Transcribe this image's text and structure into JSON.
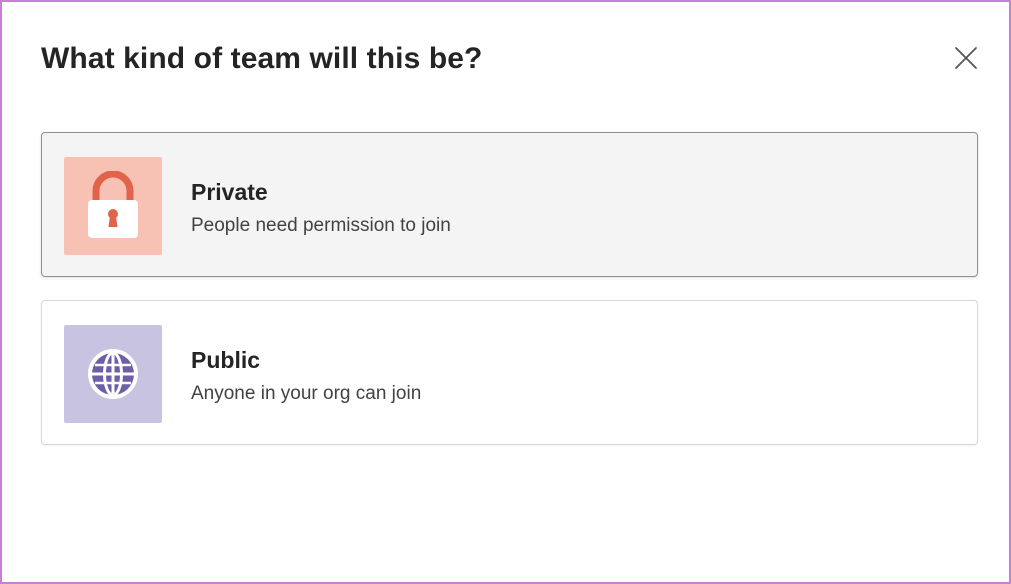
{
  "dialog": {
    "title": "What kind of team will this be?",
    "close_icon": "close-icon"
  },
  "options": [
    {
      "label": "Private",
      "description": "People need permission to join",
      "icon": "lock-icon",
      "icon_bg": "#f7c1b4",
      "selected": true
    },
    {
      "label": "Public",
      "description": "Anyone in your org can join",
      "icon": "globe-icon",
      "icon_bg": "#c9c3e2",
      "selected": false
    }
  ],
  "colors": {
    "accent_border": "#c77fd8",
    "lock": "#e0634a",
    "globe": "#6e5da8"
  }
}
